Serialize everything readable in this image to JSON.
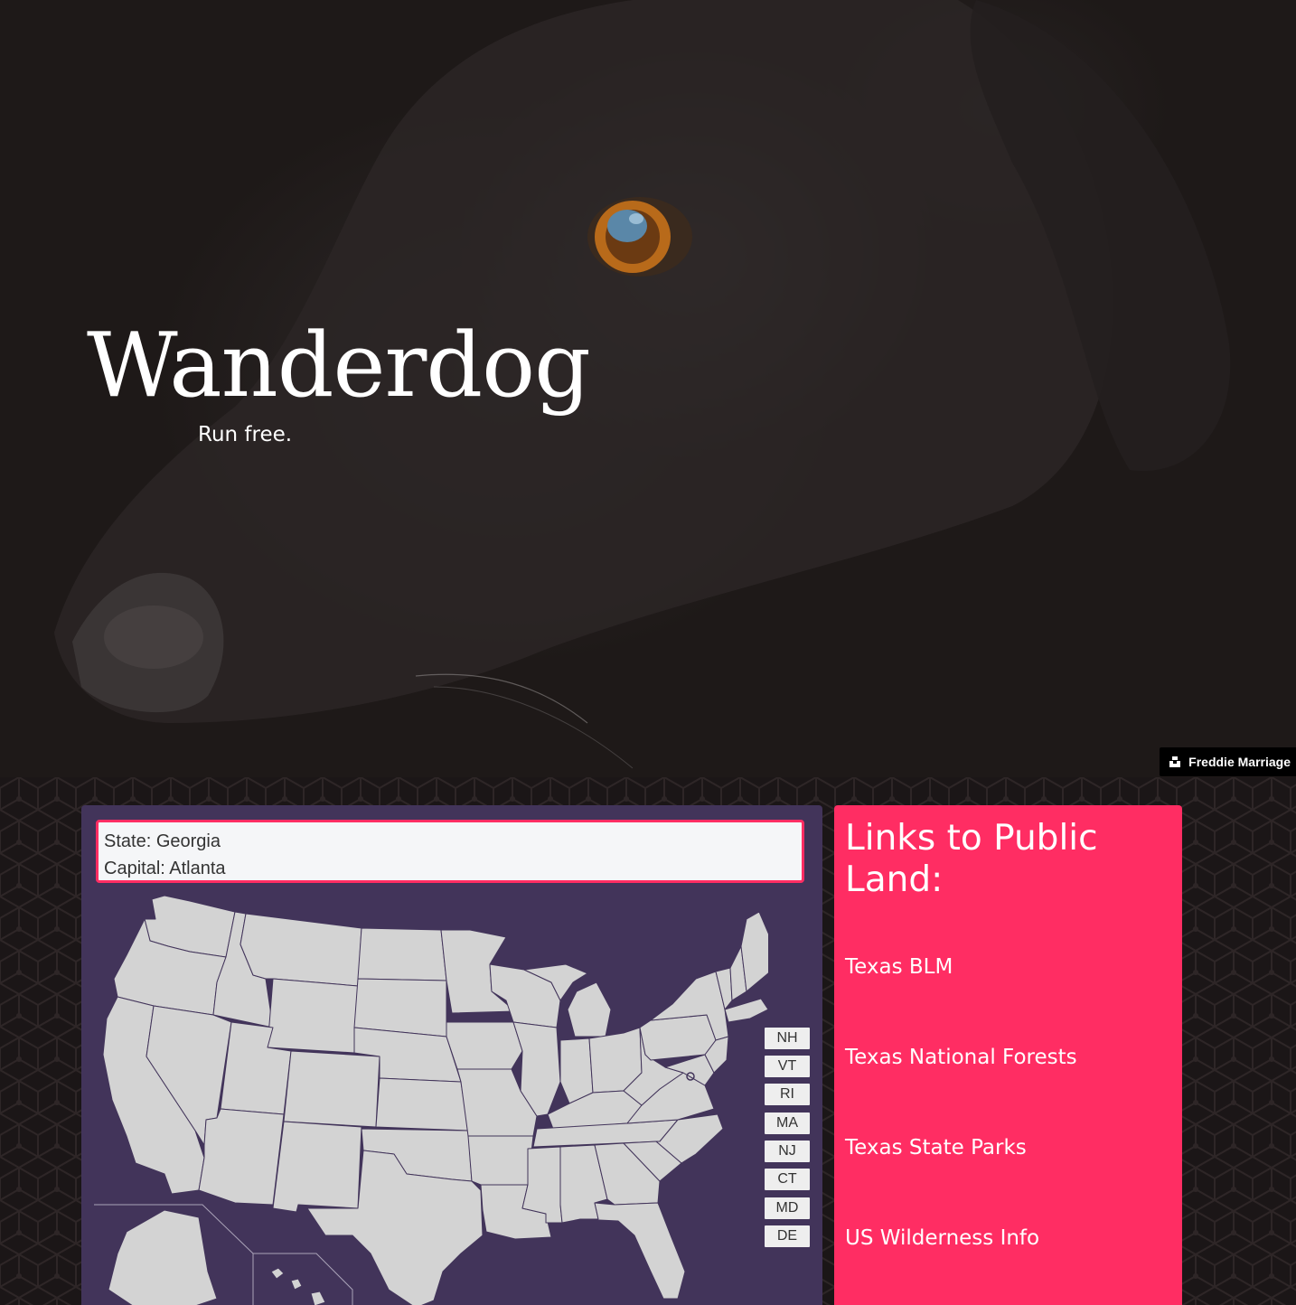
{
  "hero": {
    "title": "Wanderdog",
    "tagline": "Run free.",
    "photo_credit": "Freddie Marriage"
  },
  "map_panel": {
    "state_line": "State: Georgia",
    "capital_line": "Capital: Atlanta",
    "small_states": [
      "NH",
      "VT",
      "RI",
      "MA",
      "NJ",
      "CT",
      "MD",
      "DE"
    ]
  },
  "links_panel": {
    "title": "Links to Public Land:",
    "links": [
      "Texas BLM",
      "Texas National Forests",
      "Texas State Parks",
      "US Wilderness Info"
    ]
  },
  "colors": {
    "accent": "#ff2d63",
    "map_panel_bg": "#42345a",
    "state_fill": "#d3d3d3",
    "state_border": "#42345a"
  }
}
